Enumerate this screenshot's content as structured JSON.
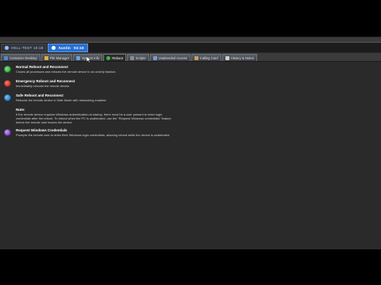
{
  "sessions": [
    {
      "label": "HELL-TEST 10:18",
      "time": "",
      "active": false
    },
    {
      "label": "Austin",
      "time": "04:16",
      "active": true
    }
  ],
  "tabs": [
    {
      "label": "Customer Desktop",
      "icon": "desktop-icon",
      "color": "#4a8ad8",
      "active": false
    },
    {
      "label": "File Manager",
      "icon": "folder-icon",
      "color": "#e0b040",
      "active": false
    },
    {
      "label": "System Info",
      "icon": "info-icon",
      "color": "#6aa0e0",
      "active": false
    },
    {
      "label": "Reboot",
      "icon": "reboot-icon",
      "color": "#3cb84a",
      "active": true
    },
    {
      "label": "Scripts",
      "icon": "script-icon",
      "color": "#8a8a8a",
      "active": false
    },
    {
      "label": "Unattended Access",
      "icon": "unattended-icon",
      "color": "#7a9ad0",
      "active": false
    },
    {
      "label": "Calling Card",
      "icon": "card-icon",
      "color": "#c8a060",
      "active": false
    },
    {
      "label": "History & Notes",
      "icon": "notes-icon",
      "color": "#d0d0d0",
      "active": false
    }
  ],
  "options": [
    {
      "title": "Normal Reboot and Reconnect",
      "desc": "Closes all processes and reboots the remote device in an orderly fashion.",
      "color": "#3cb84a"
    },
    {
      "title": "Emergency Reboot and Reconnect",
      "desc": "Immediately reboots the remote device.",
      "color": "#d23a2a"
    },
    {
      "title": "Safe Reboot and Reconnect",
      "desc": "Reboots the remote device in Safe Mode with networking enabled.",
      "color": "#2a8ad8"
    }
  ],
  "note": {
    "heading": "Note:",
    "lines": [
      "If the remote device requires Windows authentication at startup, there must be a user present to enter login",
      "credentials after the reboot. To reboot when the PC is unattended, use the \"Request Windows credentials\" feature",
      "before the remote user leaves the device."
    ]
  },
  "credentials": {
    "title": "Request Windows Credentials",
    "desc": "Prompts the remote user to enter their Windows login credentials, allowing reboot while the device is unattended.",
    "color": "#8a4ac8"
  }
}
